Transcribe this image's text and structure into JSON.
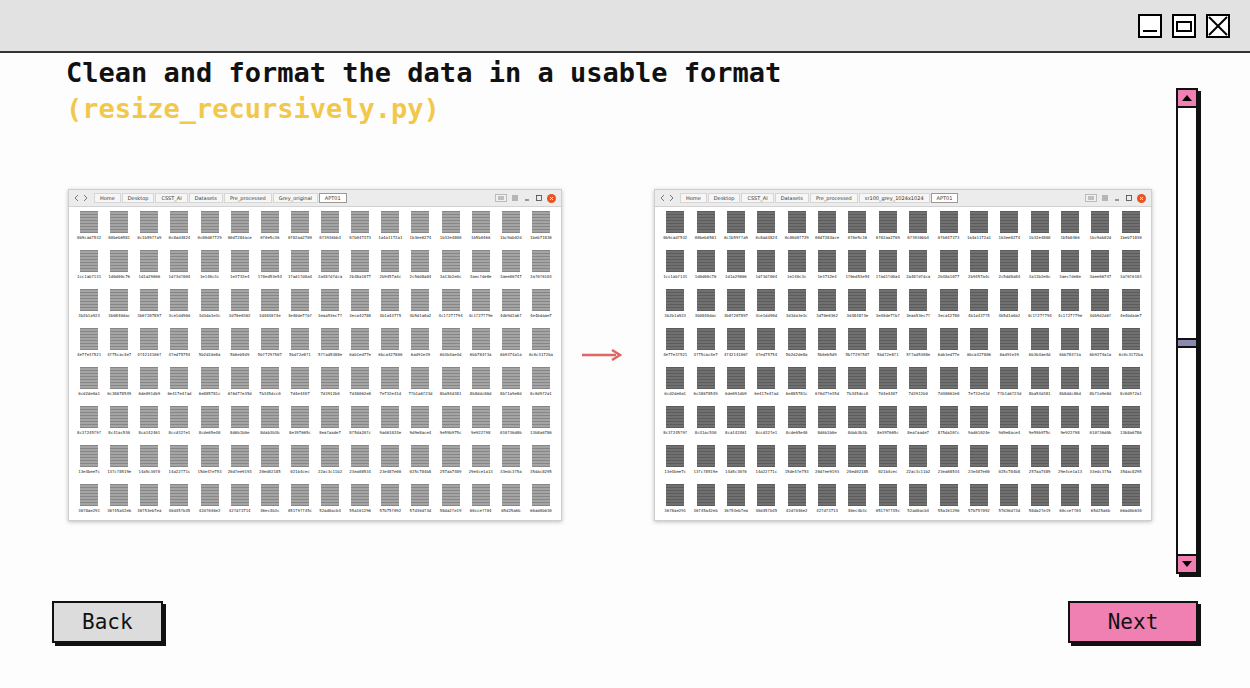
{
  "window_controls": [
    {
      "kind": "minimize"
    },
    {
      "kind": "maximize"
    },
    {
      "kind": "close"
    }
  ],
  "title": "Clean and format the data in a usable format",
  "subtitle": "(resize_recursively.py)",
  "screenshots": [
    {
      "path": [
        {
          "label": "Home",
          "selected": false
        },
        {
          "label": "Desktop",
          "selected": false
        },
        {
          "label": "CSST_AI",
          "selected": false
        },
        {
          "label": "Datasets",
          "selected": false
        },
        {
          "label": "Pre_processed",
          "selected": false
        },
        {
          "label": "Grey_original",
          "selected": false
        },
        {
          "label": "APT01",
          "selected": true
        }
      ],
      "thumbnail_color": "#a4a4a4"
    },
    {
      "path": [
        {
          "label": "Home",
          "selected": false
        },
        {
          "label": "Desktop",
          "selected": false
        },
        {
          "label": "CSST_AI",
          "selected": false
        },
        {
          "label": "Datasets",
          "selected": false
        },
        {
          "label": "Pre_processed",
          "selected": false
        },
        {
          "label": "sr100_grey_1024x1024",
          "selected": false
        },
        {
          "label": "APT01",
          "selected": true
        }
      ],
      "thumbnail_color": "#707070"
    }
  ],
  "files_in_both_screenshots": [
    "0b9cadf532",
    "00beb6581",
    "0c1b59ffa9",
    "0c8ad4824",
    "0c00d0f729",
    "00d7284ace",
    "0f0e5c36",
    "0f02aa2769",
    "0f3936bb4",
    "0fb047373",
    "1a4a1172a1",
    "1b3ee0274",
    "1b32e4800",
    "1b5b0466",
    "1bc9ab02d",
    "1beb71830",
    "1cc1abf131",
    "1d0d00c76",
    "1d1a29066",
    "1df3df004",
    "1e140c3c",
    "1e3732e4",
    "1f0ed53e54",
    "1fad1fd0a4",
    "2a48fdfdca",
    "2b48a1077",
    "2b9457a4c",
    "2c5dd8a84",
    "3a13b2e0c",
    "3aecfde8e",
    "3aee06747",
    "3af0f6103",
    "3b2b1a923",
    "3b0840dac",
    "3b0f207897",
    "3ce1dd90d",
    "3d3da3e3c",
    "3d70e0362",
    "3d4848f4e",
    "3e40de7fbf",
    "3eaa53ec7f",
    "3eca42780",
    "4b1a437f5",
    "4b5d1a0a2",
    "4c1f27f794",
    "4c1f27f79e",
    "4db9d2a6f",
    "4e4bdaae7",
    "4e77e3f521",
    "4f75cac4e7",
    "4f4214106f",
    "4fed75754",
    "5b2d2de8a",
    "5b6eb5d9",
    "5bf729f507",
    "5bdf2e8f1",
    "5ffad5308e",
    "6ab1ed77e",
    "6bca427806",
    "6ad91e39",
    "6b3b4ae4d",
    "6bb784f3a",
    "6b9374a1a",
    "6c0c3172ba",
    "6cd2de0a1",
    "6c38678549",
    "6de091db9",
    "6e417e4fad",
    "6e885781c",
    "6f6d7fe35d",
    "7b345dcc0",
    "7d4e4407",
    "7d3912b0",
    "7d40062e8",
    "7e732e41d",
    "7fb1a6f23d",
    "8ba54d381",
    "8b8ddc86d",
    "8bf1a9e8d",
    "8c0d9f2a1",
    "8c3f245f9f",
    "8c41ac530",
    "8ca142461",
    "8ccd32fe1",
    "8cde65e40",
    "8d6b1b0e",
    "8dab3b3b",
    "8e397665c",
    "8eafaade7",
    "8f5da20fc",
    "9ad61024e",
    "9d9e8ace4",
    "9e59b975c",
    "9e922f98",
    "010f36d0b",
    "13b8a6786",
    "13e4bee7c",
    "13fcf8519e",
    "14a5c30f0",
    "14a22f71c",
    "15de4fe753",
    "20dfee9193",
    "20ed02185",
    "021b4cec",
    "22ac3c11b2",
    "23ea08534",
    "23e487e00",
    "025c784b8",
    "257aa7489",
    "29e4ce1a13",
    "33edc3f5a",
    "35dac8295",
    "36f8ae291",
    "36f45a42eb",
    "36f53eb7ea",
    "40d45fb45",
    "42df046e2",
    "42fdf3714",
    "46ec4b3c",
    "051f9ff45c",
    "52ad0acb4",
    "55a161296",
    "57b75f092",
    "57d36df3d",
    "58da2fe19",
    "60cceff04",
    "65d25a6b",
    "66ad0b630"
  ],
  "scrollbar": {
    "level": 0.53
  },
  "buttons": [
    {
      "label": "Back",
      "kind": "secondary"
    },
    {
      "label": "Next",
      "kind": "primary"
    }
  ]
}
